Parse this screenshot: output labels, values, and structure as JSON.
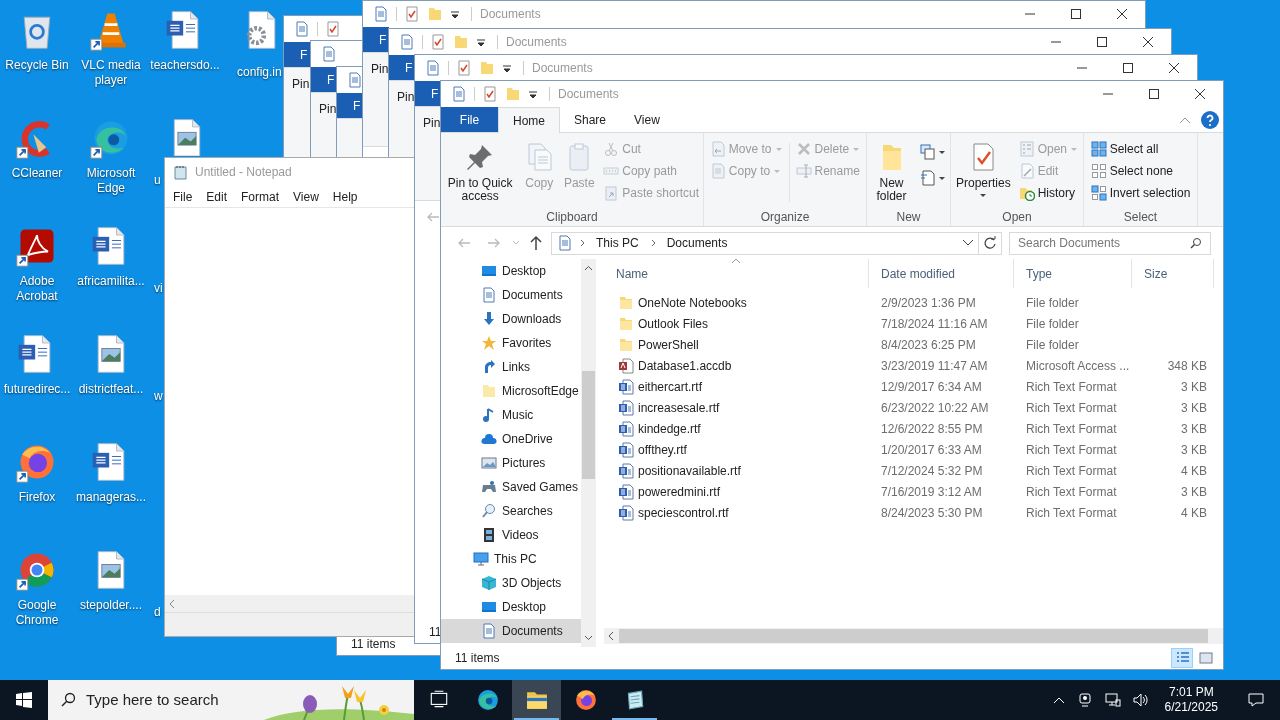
{
  "desktop_icons": [
    {
      "label": "Recycle Bin"
    },
    {
      "label": "CCleaner"
    },
    {
      "label": "Adobe Acrobat"
    },
    {
      "label": "futuredirec..."
    },
    {
      "label": "Firefox"
    },
    {
      "label": "Google Chrome"
    },
    {
      "label": "VLC media player"
    },
    {
      "label": "Microsoft Edge"
    },
    {
      "label": "africamilita..."
    },
    {
      "label": "districtfeat..."
    },
    {
      "label": "manageras..."
    },
    {
      "label": "stepolder...."
    },
    {
      "label": "teachersdo..."
    },
    {
      "label": "u"
    },
    {
      "label": "vi"
    },
    {
      "label": "w"
    },
    {
      "label": "d"
    },
    {
      "label": "config.in"
    }
  ],
  "background_windows": [
    {
      "title": "Documents",
      "tab": "F",
      "ribbon_texts": [
        "Pin"
      ]
    },
    {
      "tab": "F",
      "ribbon_texts": [
        "Pin"
      ]
    },
    {
      "title": "Documents",
      "tab": "F",
      "ribbon_texts": [
        "Pin"
      ]
    },
    {
      "tab": "F",
      "ribbon_texts": [
        "Pin"
      ]
    },
    {
      "title": "Documents",
      "tab": "F",
      "ribbon_texts": [
        "Pin"
      ],
      "status": "11"
    },
    {
      "tab": "F",
      "status": "11 items"
    }
  ],
  "notepad": {
    "title": "Untitled - Notepad",
    "menu": [
      "File",
      "Edit",
      "Format",
      "View",
      "Help"
    ]
  },
  "explorer": {
    "title": "Documents",
    "ribbon": {
      "tabs": [
        {
          "label": "File",
          "selected": false,
          "kind": "file"
        },
        {
          "label": "Home",
          "selected": true,
          "kind": "tab"
        },
        {
          "label": "Share",
          "selected": false,
          "kind": "tab"
        },
        {
          "label": "View",
          "selected": false,
          "kind": "tab"
        }
      ],
      "groups": [
        {
          "label": "Clipboard",
          "columns": [
            [
              {
                "kind": "large",
                "label": "Pin to Quick access",
                "disabled": false
              }
            ],
            [
              {
                "kind": "large",
                "label": "Copy",
                "disabled": true
              }
            ],
            [
              {
                "kind": "large",
                "label": "Paste",
                "disabled": true
              }
            ],
            [
              {
                "kind": "small",
                "label": "Cut",
                "disabled": true
              },
              {
                "kind": "small",
                "label": "Copy path",
                "disabled": true
              },
              {
                "kind": "small",
                "label": "Paste shortcut",
                "disabled": true
              }
            ]
          ]
        },
        {
          "label": "Organize",
          "columns": [
            [
              {
                "kind": "small",
                "label": "Move to",
                "disabled": true,
                "dropdown": true
              },
              {
                "kind": "small",
                "label": "Copy to",
                "disabled": true,
                "dropdown": true
              }
            ],
            [
              {
                "kind": "small",
                "label": "Delete",
                "disabled": true,
                "dropdown": true
              },
              {
                "kind": "small",
                "label": "Rename",
                "disabled": true
              }
            ]
          ]
        },
        {
          "label": "New",
          "columns": [
            [
              {
                "kind": "large",
                "label": "New folder",
                "disabled": false
              }
            ],
            [
              {
                "kind": "icon",
                "dropdown": true
              },
              {
                "kind": "icon",
                "dropdown": true
              }
            ]
          ]
        },
        {
          "label": "Open",
          "columns": [
            [
              {
                "kind": "large",
                "label": "Properties",
                "disabled": false,
                "dropdown": true
              }
            ],
            [
              {
                "kind": "small",
                "label": "Open",
                "disabled": true,
                "dropdown": true
              },
              {
                "kind": "small",
                "label": "Edit",
                "disabled": true
              },
              {
                "kind": "small",
                "label": "History",
                "disabled": false
              }
            ]
          ]
        },
        {
          "label": "Select",
          "columns": [
            [
              {
                "kind": "small",
                "label": "Select all",
                "disabled": false
              },
              {
                "kind": "small",
                "label": "Select none",
                "disabled": false
              },
              {
                "kind": "small",
                "label": "Invert selection",
                "disabled": false
              }
            ]
          ]
        }
      ]
    },
    "address": {
      "segments": [
        "This PC",
        "Documents"
      ]
    },
    "search": {
      "placeholder": "Search Documents"
    },
    "navigation": {
      "user_folder_children": [
        {
          "label": "Desktop",
          "selected": false
        },
        {
          "label": "Documents",
          "selected": false
        },
        {
          "label": "Downloads",
          "selected": false
        },
        {
          "label": "Favorites",
          "selected": false
        },
        {
          "label": "Links",
          "selected": false
        },
        {
          "label": "MicrosoftEdge",
          "selected": false
        },
        {
          "label": "Music",
          "selected": false
        },
        {
          "label": "OneDrive",
          "selected": false
        },
        {
          "label": "Pictures",
          "selected": false
        },
        {
          "label": "Saved Games",
          "selected": false
        },
        {
          "label": "Searches",
          "selected": false
        },
        {
          "label": "Videos",
          "selected": false
        }
      ],
      "this_pc": {
        "label": "This PC",
        "selected": false,
        "children": [
          {
            "label": "3D Objects",
            "selected": false
          },
          {
            "label": "Desktop",
            "selected": false
          },
          {
            "label": "Documents",
            "selected": true
          }
        ]
      }
    },
    "columns": [
      {
        "label": "Name",
        "sorted": true
      },
      {
        "label": "Date modified",
        "sorted": false
      },
      {
        "label": "Type",
        "sorted": false
      },
      {
        "label": "Size",
        "sorted": false
      }
    ],
    "rows": [
      {
        "kind": "folder",
        "name": "OneNote Notebooks",
        "date": "2/9/2023 1:36 PM",
        "type": "File folder"
      },
      {
        "kind": "folder",
        "name": "Outlook Files",
        "date": "7/18/2024 11:16 AM",
        "type": "File folder"
      },
      {
        "kind": "folder",
        "name": "PowerShell",
        "date": "8/4/2023 6:25 PM",
        "type": "File folder"
      },
      {
        "kind": "database",
        "name": "Database1.accdb",
        "date": "3/23/2019 11:47 AM",
        "type": "Microsoft Access ...",
        "size": "348 KB"
      },
      {
        "kind": "document",
        "name": "eithercart.rtf",
        "date": "12/9/2017 6:34 AM",
        "type": "Rich Text Format",
        "size": "3 KB"
      },
      {
        "kind": "document",
        "name": "increasesale.rtf",
        "date": "6/23/2022 10:22 AM",
        "type": "Rich Text Format",
        "size": "3 KB"
      },
      {
        "kind": "document",
        "name": "kindedge.rtf",
        "date": "12/6/2022 8:55 PM",
        "type": "Rich Text Format",
        "size": "3 KB"
      },
      {
        "kind": "document",
        "name": "offthey.rtf",
        "date": "1/20/2017 6:33 AM",
        "type": "Rich Text Format",
        "size": "3 KB"
      },
      {
        "kind": "document",
        "name": "positionavailable.rtf",
        "date": "7/12/2024 5:32 PM",
        "type": "Rich Text Format",
        "size": "4 KB"
      },
      {
        "kind": "document",
        "name": "poweredmini.rtf",
        "date": "7/16/2019 3:12 AM",
        "type": "Rich Text Format",
        "size": "3 KB"
      },
      {
        "kind": "document",
        "name": "speciescontrol.rtf",
        "date": "8/24/2023 5:30 PM",
        "type": "Rich Text Format",
        "size": "4 KB"
      }
    ],
    "status": "11 items",
    "view_buttons": [
      {
        "selected": true
      },
      {
        "selected": false
      }
    ]
  },
  "taskbar": {
    "search_placeholder": "Type here to search",
    "apps": [
      {
        "running": false,
        "selected": false
      },
      {
        "running": false,
        "selected": false
      },
      {
        "running": true,
        "selected": true
      },
      {
        "running": false,
        "selected": false
      },
      {
        "running": true,
        "selected": false
      }
    ],
    "time": "7:01 PM",
    "date": "6/21/2025"
  }
}
